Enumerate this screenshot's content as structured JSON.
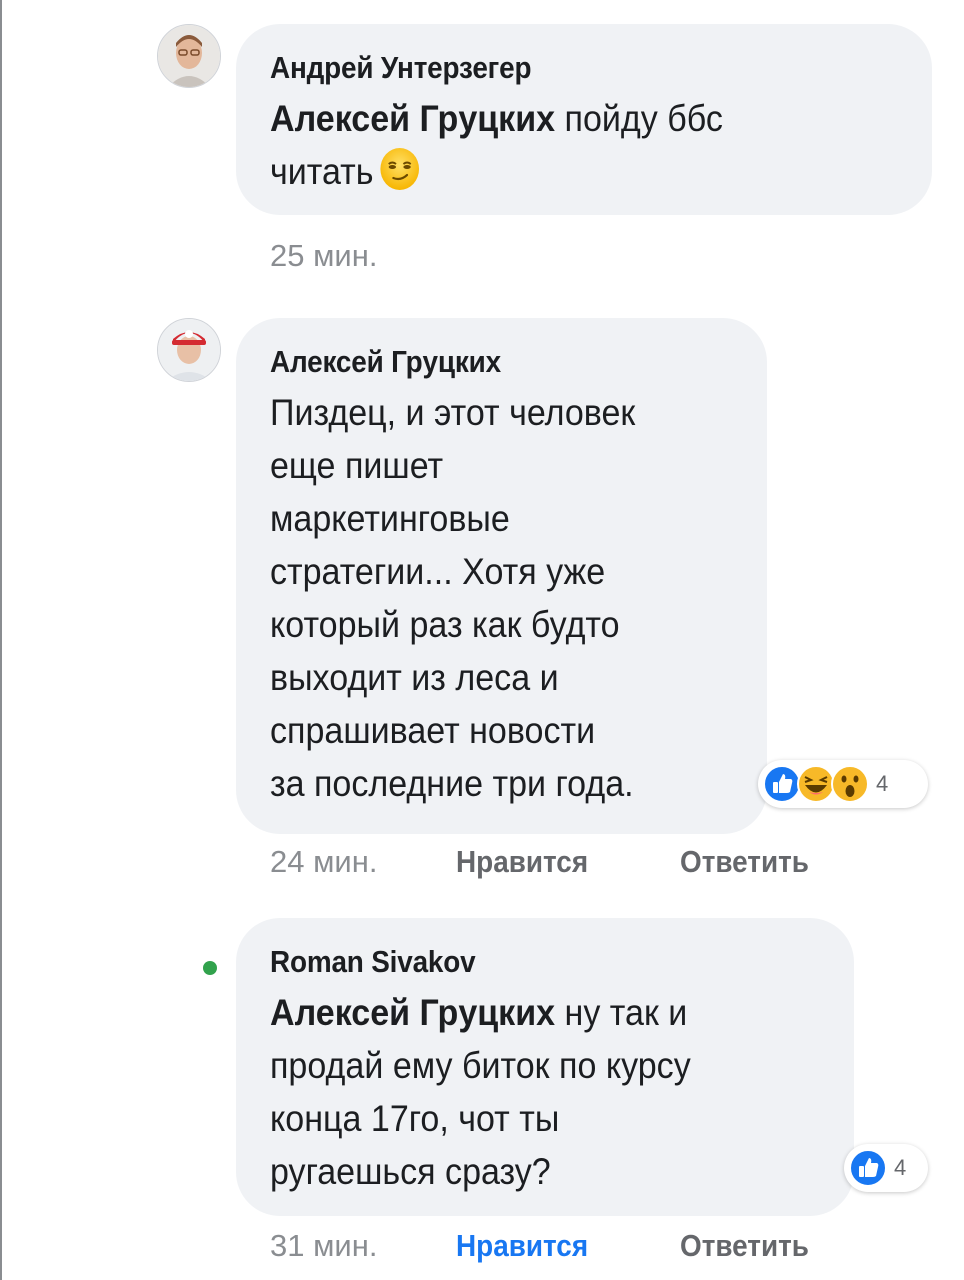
{
  "comments": [
    {
      "author": "Андрей Унтерзегер",
      "mention": "Алексей Грyцких",
      "line1_rest": " пойду ббс",
      "line2": "читать",
      "emoji": "smirk-emoji",
      "time": "25 мин."
    },
    {
      "author": "Алексей Грyцких",
      "lines": [
        "Пиздец, и этот человек",
        "еще пишет",
        "маркетинговые",
        "стратегии... Хотя уже",
        "который раз как будто",
        "выходит из леса и",
        "спрашивает новости",
        "за последние три года."
      ],
      "reactions": {
        "icons": [
          "like-icon",
          "haha-icon",
          "wow-icon"
        ],
        "count": "4"
      },
      "time": "24 мин.",
      "like_label": "Нравится",
      "reply_label": "Ответить"
    },
    {
      "author": "Roman Sivakov",
      "mention": "Алексей Грyцких",
      "line1_rest": " ну так и",
      "lines": [
        "продай ему биток по курсу",
        "конца 17го, чот ты",
        "ругаешься сразу?"
      ],
      "reactions": {
        "icons": [
          "like-icon"
        ],
        "count": "4"
      },
      "time": "31 мин.",
      "like_label": "Нравится",
      "reply_label": "Ответить",
      "liked": true
    }
  ],
  "colors": {
    "bubble": "#f0f2f5",
    "like_blue": "#1877f2",
    "meta_gray": "#8a8d91",
    "action_gray": "#65676b",
    "online_green": "#31a24c"
  }
}
